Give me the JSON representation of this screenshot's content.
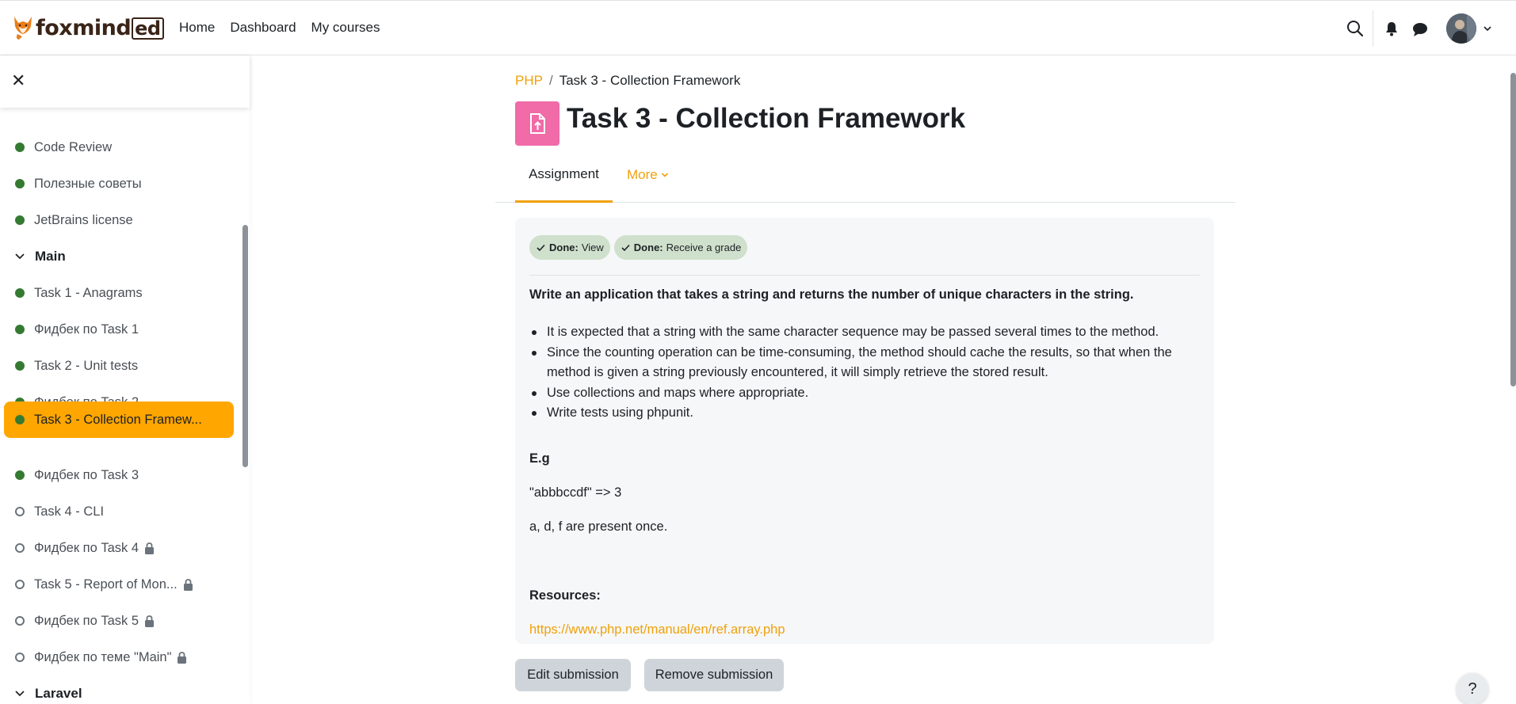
{
  "brand": {
    "name": "foxmind",
    "suffix": "ed"
  },
  "nav": {
    "links": [
      "Home",
      "Dashboard",
      "My courses"
    ]
  },
  "sidebar": {
    "close_glyph": "✕",
    "items": [
      {
        "label": "Code Review",
        "status": "done",
        "locked": false
      },
      {
        "label": "Полезные советы",
        "status": "done",
        "locked": false
      },
      {
        "label": "JetBrains license",
        "status": "done",
        "locked": false
      },
      {
        "label": "Main",
        "type": "section"
      },
      {
        "label": "Task 1 - Anagrams",
        "status": "done",
        "locked": false
      },
      {
        "label": "Фидбек по Task 1",
        "status": "done",
        "locked": false
      },
      {
        "label": "Task 2 - Unit tests",
        "status": "done",
        "locked": false
      },
      {
        "label": "Фидбек по Task 2",
        "status": "done",
        "locked": false
      },
      {
        "label": "Task 3 - Collection Framew...",
        "status": "done",
        "locked": false,
        "active": true
      },
      {
        "label": "Фидбек по Task 3",
        "status": "done",
        "locked": false
      },
      {
        "label": "Task 4 - CLI",
        "status": "empty",
        "locked": false
      },
      {
        "label": "Фидбек по Task 4",
        "status": "empty",
        "locked": true
      },
      {
        "label": "Task 5 - Report of Mon...",
        "status": "empty",
        "locked": true
      },
      {
        "label": "Фидбек по Task 5",
        "status": "empty",
        "locked": true
      },
      {
        "label": "Фидбек по теме \"Main\"",
        "status": "empty",
        "locked": true
      },
      {
        "label": "Laravel",
        "type": "section"
      }
    ]
  },
  "breadcrumb": {
    "course": "PHP",
    "separator": "/",
    "current": "Task 3 - Collection Framework"
  },
  "page": {
    "title": "Task 3 - Collection Framework",
    "icon": "assignment-upload-icon",
    "icon_color": "#f06ba8"
  },
  "tabs": {
    "assignment": "Assignment",
    "more": "More"
  },
  "completion": [
    {
      "prefix": "Done:",
      "text": "View"
    },
    {
      "prefix": "Done:",
      "text": "Receive a grade"
    }
  ],
  "content": {
    "heading": "Write an application that takes a string and returns the number of unique characters in the string.",
    "bullets": [
      "It is expected that a string with the same character sequence may be passed several times to the method.",
      "Since the counting operation can be time-consuming, the method should cache the results, so that when the method is given a string previously encountered, it will simply retrieve the stored result.",
      "Use collections and maps where appropriate.",
      "Write tests using phpunit."
    ],
    "example_label": "E.g",
    "example_input": "\"abbbccdf\" => 3",
    "example_note": "a, d, f are present once.",
    "resources_label": "Resources:",
    "resources_link": "https://www.php.net/manual/en/ref.array.php"
  },
  "actions": {
    "edit": "Edit submission",
    "remove": "Remove submission"
  },
  "help": "?",
  "colors": {
    "accent": "#f0a10a",
    "active_item": "#ffa600",
    "done_dot": "#357a32",
    "badge_bg": "#cfe0cc"
  }
}
